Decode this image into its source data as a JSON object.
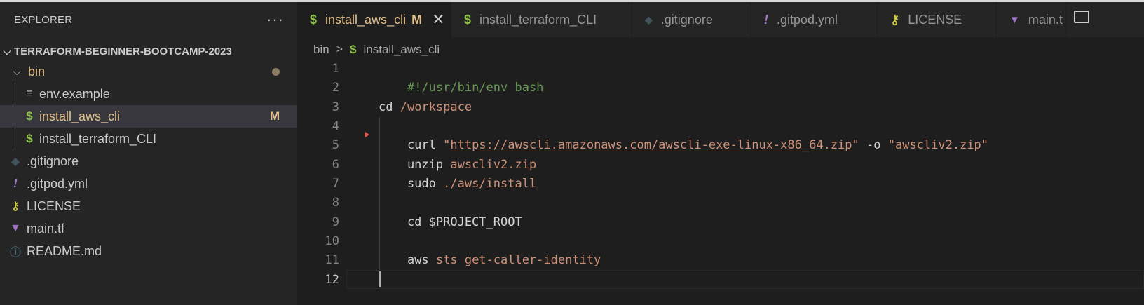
{
  "explorer": {
    "title": "EXPLORER",
    "more": "···",
    "root_folder": "TERRAFORM-BEGINNER-BOOTCAMP-2023",
    "items": [
      {
        "label": "bin",
        "icon": "chevron-down-icon"
      },
      {
        "label": "env.example",
        "icon": "lines-icon"
      },
      {
        "label": "install_aws_cli",
        "icon": "dollar-icon",
        "badge": "M"
      },
      {
        "label": "install_terraform_CLI",
        "icon": "dollar-icon"
      },
      {
        "label": ".gitignore",
        "icon": "git-icon"
      },
      {
        "label": ".gitpod.yml",
        "icon": "exclamation-icon"
      },
      {
        "label": "LICENSE",
        "icon": "license-icon"
      },
      {
        "label": "main.tf",
        "icon": "terraform-icon"
      },
      {
        "label": "README.md",
        "icon": "info-icon"
      }
    ]
  },
  "tabs": [
    {
      "label": "install_aws_cli",
      "modified": "M",
      "icon": "dollar-icon"
    },
    {
      "label": "install_terraform_CLI",
      "icon": "dollar-icon"
    },
    {
      "label": ".gitignore",
      "icon": "git-icon"
    },
    {
      "label": ".gitpod.yml",
      "icon": "exclamation-icon"
    },
    {
      "label": "LICENSE",
      "icon": "license-icon"
    },
    {
      "label": "main.t",
      "icon": "terraform-icon"
    }
  ],
  "breadcrumb": {
    "folder": "bin",
    "file": "install_aws_cli"
  },
  "editor": {
    "line_numbers": [
      "1",
      "2",
      "3",
      "4",
      "5",
      "6",
      "7",
      "8",
      "9",
      "10",
      "11",
      "12"
    ],
    "line1": "#!/usr/bin/env bash",
    "line3_cmd": "cd ",
    "line3_arg": "/workspace",
    "line5_cmd": "    curl ",
    "line5_q1": "\"",
    "line5_url": "https://awscli.amazonaws.com/awscli-exe-linux-x86_64.zip",
    "line5_q2": "\"",
    "line5_opt": " -o ",
    "line5_out": "\"awscliv2.zip\"",
    "line6_cmd": "    unzip ",
    "line6_arg": "awscliv2.zip",
    "line7_cmd": "    sudo ",
    "line7_arg": "./aws/install",
    "line9": "    cd $PROJECT_ROOT",
    "line11_cmd": "    aws ",
    "line11_arg": "sts get-caller-identity"
  },
  "colors": {
    "modified": "#e2c08d",
    "shell_icon": "#8dc149",
    "string": "#ce9178",
    "comment": "#6a9955"
  }
}
